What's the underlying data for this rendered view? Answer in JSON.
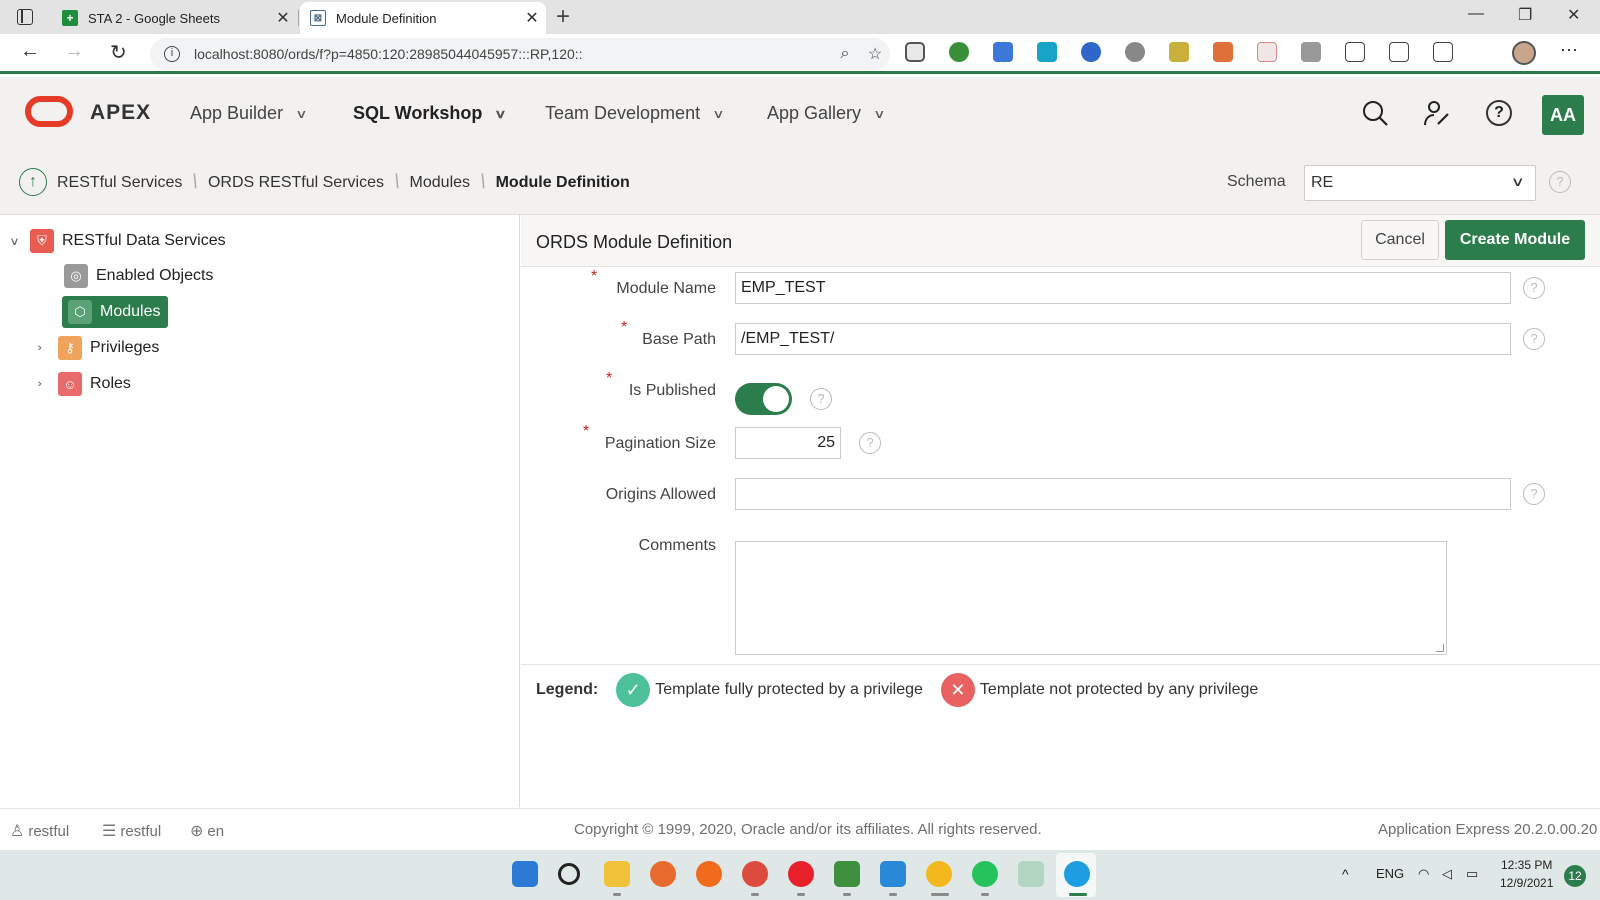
{
  "browser": {
    "tabs": [
      {
        "label": "STA 2 - Google Sheets",
        "favicon": "sheets-icon"
      },
      {
        "label": "Module Definition",
        "favicon": "apex-icon"
      }
    ],
    "close_glyph": "✕",
    "new_tab_glyph": "+",
    "url": "localhost:8080/ords/f?p=4850:120:28985044045957:::RP,120::",
    "window_controls": {
      "minimize": "—",
      "restore": "❐",
      "close": "✕"
    }
  },
  "apex_header": {
    "brand": "APEX",
    "nav": [
      {
        "label": "App Builder",
        "active": false
      },
      {
        "label": "SQL Workshop",
        "active": true
      },
      {
        "label": "Team Development",
        "active": false
      },
      {
        "label": "App Gallery",
        "active": false
      }
    ],
    "user_initials": "AA"
  },
  "breadcrumb": {
    "items": [
      "RESTful Services",
      "ORDS RESTful Services",
      "Modules"
    ],
    "current": "Module Definition",
    "schema_label": "Schema",
    "schema_value": "RE"
  },
  "tree": {
    "root": "RESTful Data Services",
    "items": [
      {
        "label": "Enabled Objects",
        "selected": false,
        "expandable": false
      },
      {
        "label": "Modules",
        "selected": true,
        "expandable": false
      },
      {
        "label": "Privileges",
        "selected": false,
        "expandable": true
      },
      {
        "label": "Roles",
        "selected": false,
        "expandable": true
      }
    ]
  },
  "region": {
    "title": "ORDS Module Definition",
    "cancel_label": "Cancel",
    "create_label": "Create Module"
  },
  "form": {
    "module_name": {
      "label": "Module Name",
      "value": "EMP_TEST",
      "required": true
    },
    "base_path": {
      "label": "Base Path",
      "value": "/EMP_TEST/",
      "required": true
    },
    "is_published": {
      "label": "Is Published",
      "value": true,
      "required": true
    },
    "pagination_size": {
      "label": "Pagination Size",
      "value": "25",
      "required": true
    },
    "origins_allowed": {
      "label": "Origins Allowed",
      "value": "",
      "required": false
    },
    "comments": {
      "label": "Comments",
      "value": "",
      "required": false
    },
    "required_mark": "*",
    "help_glyph": "?"
  },
  "legend": {
    "title": "Legend:",
    "protected": "Template fully protected by a privilege",
    "not_protected": "Template not protected by any privilege"
  },
  "footer": {
    "user": "restful",
    "workspace": "restful",
    "language": "en",
    "copyright": "Copyright © 1999, 2020, Oracle and/or its affiliates. All rights reserved.",
    "version": "Application Express 20.2.0.00.20"
  },
  "taskbar": {
    "lang": "ENG",
    "time": "12:35 PM",
    "date": "12/9/2021",
    "notifications": "12"
  },
  "colors": {
    "apex_green": "#2c7d4c",
    "oracle_red": "#e53b27",
    "legend_ok": "#4fc19a",
    "legend_bad": "#e86262"
  }
}
